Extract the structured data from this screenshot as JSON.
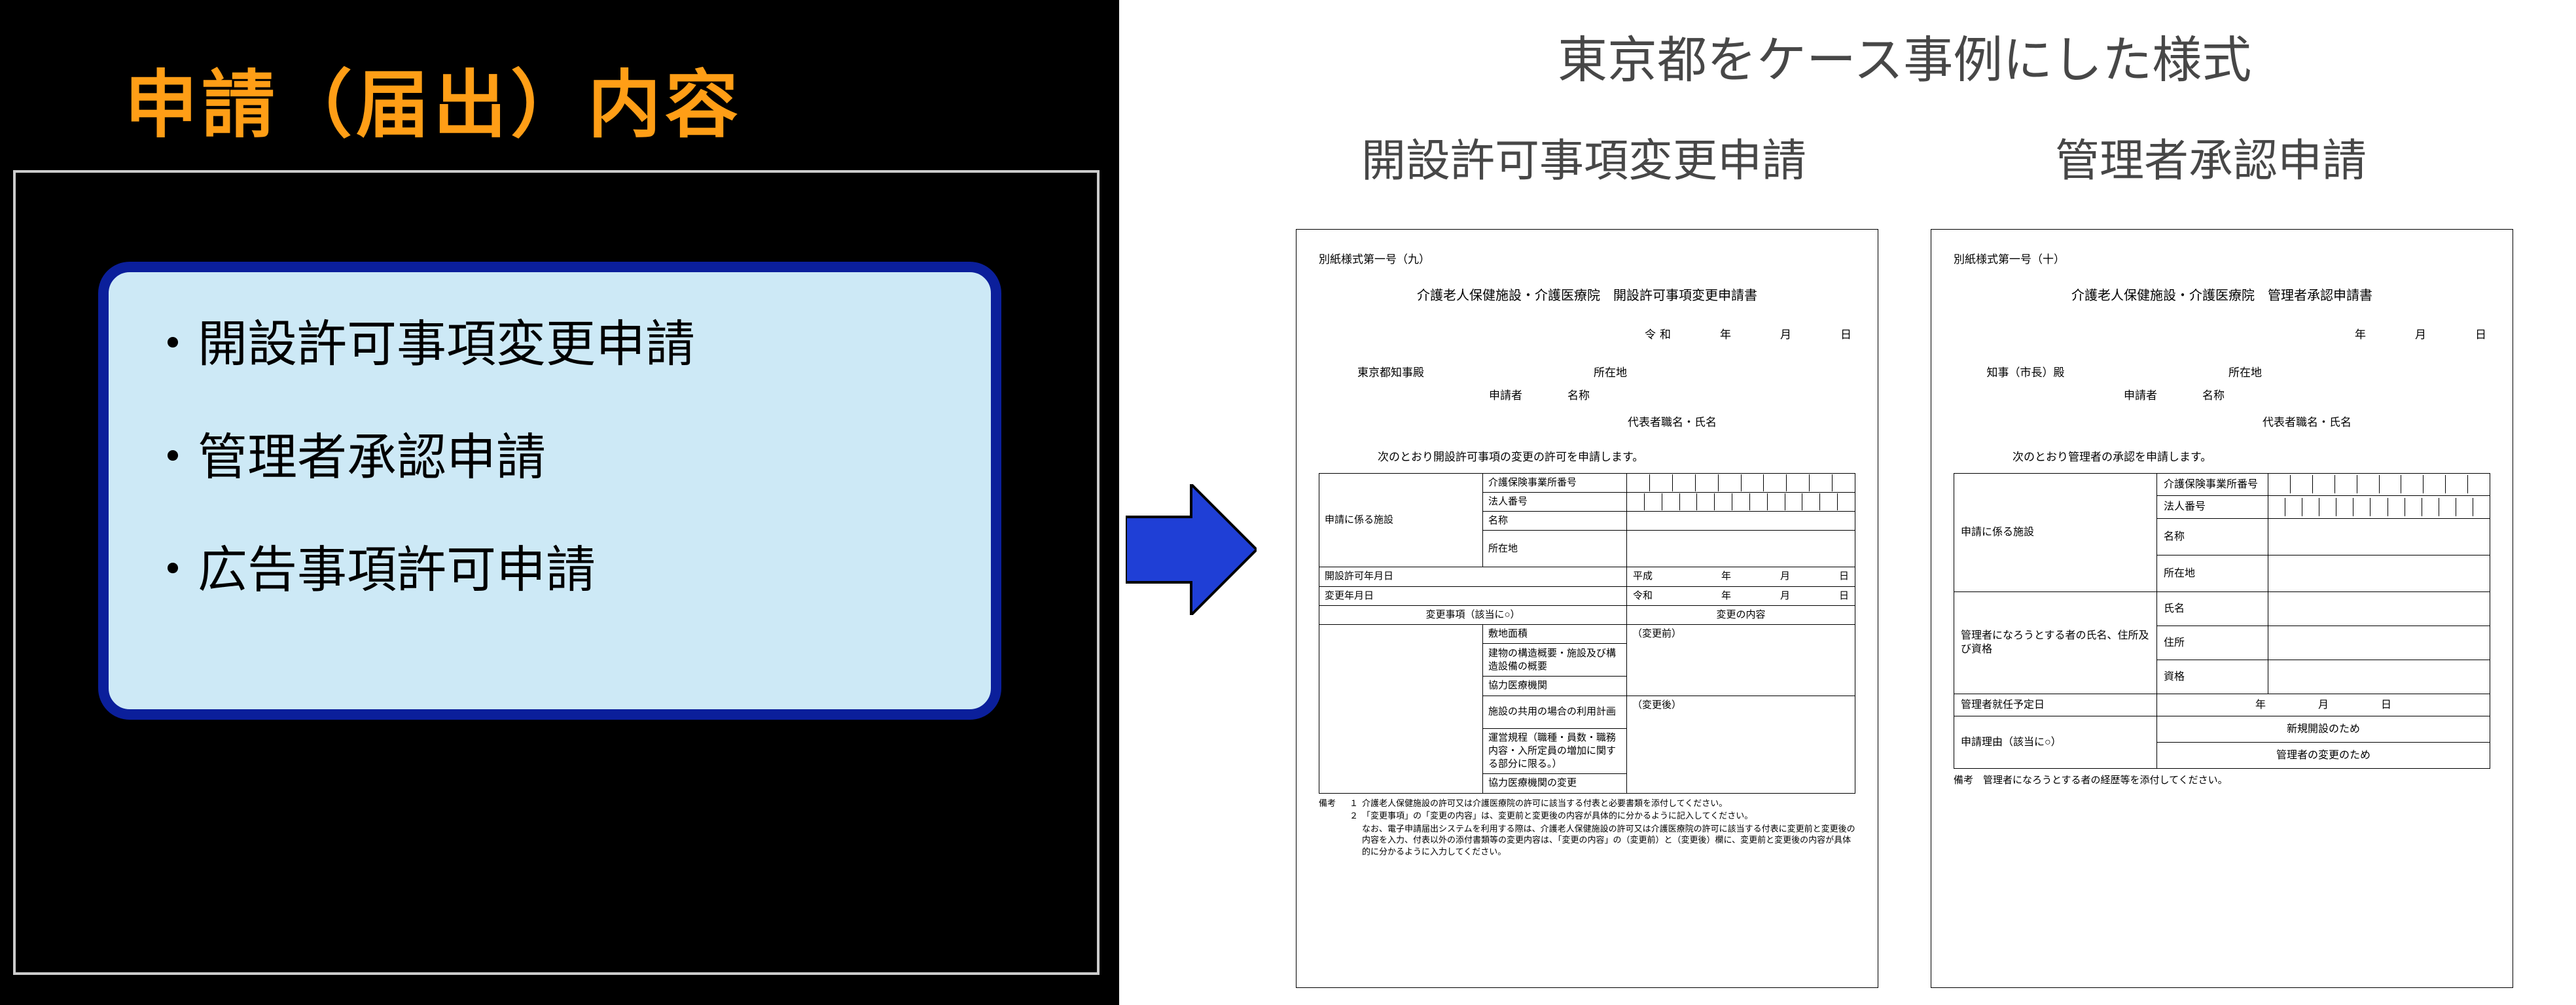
{
  "title": "申請（届出）内容",
  "bullets": [
    "・開設許可事項変更申請",
    "・管理者承認申請",
    "・広告事項許可申請"
  ],
  "topLabel": "東京都をケース事例にした様式",
  "subLabel1": "開設許可事項変更申請",
  "subLabel2": "管理者承認申請",
  "form1": {
    "code": "別紙様式第一号（九）",
    "title": "介護老人保健施設・介護医療院　開設許可事項変更申請書",
    "date": "令和　　　年　　　月　　　日",
    "recipient": "東京都知事殿",
    "addr": "所在地",
    "applicant": "申請者",
    "name": "名称",
    "rep": "代表者職名・氏名",
    "statement": "次のとおり開設許可事項の変更の許可を申請します。",
    "t": {
      "rowFac": "申請に係る施設",
      "insNo": "介護保険事業所番号",
      "corpNo": "法人番号",
      "facName": "名称",
      "facAddr": "所在地",
      "permitDate": "開設許可年月日",
      "permitVal": "平成　　　　　　　年　　　　　月　　　　　日",
      "chgDate": "変更年月日",
      "chgVal": "令和　　　　　　　年　　　　　月　　　　　日",
      "chgHdr": "変更事項（該当に○）",
      "contHdr": "変更の内容",
      "site": "敷地面積",
      "before": "（変更前）",
      "bldg": "建物の構造概要・施設及び構造設備の概要",
      "coop": "協力医療機関",
      "after": "（変更後）",
      "share": "施設の共用の場合の利用計画",
      "rules": "運営規程（職種・員数・職務内容・入所定員の増加に関する部分に限る。）",
      "medchg": "協力医療機関の変更"
    },
    "notes": {
      "label": "備考",
      "n1": "介護老人保健施設の許可又は介護医療院の許可に該当する付表と必要書類を添付してください。",
      "n2": "「変更事項」の「変更の内容」は、変更前と変更後の内容が具体的に分かるように記入してください。",
      "n2b": "なお、電子申請届出システムを利用する際は、介護老人保健施設の許可又は介護医療院の許可に該当する付表に変更前と変更後の内容を入力、付表以外の添付書類等の変更内容は、「変更の内容」の（変更前）と（変更後）欄に、変更前と変更後の内容が具体的に分かるように入力してください。"
    }
  },
  "form2": {
    "code": "別紙様式第一号（十）",
    "title": "介護老人保健施設・介護医療院　管理者承認申請書",
    "date": "年　　　月　　　日",
    "recipient": "知事（市長）殿",
    "addr": "所在地",
    "applicant": "申請者",
    "name": "名称",
    "rep": "代表者職名・氏名",
    "statement": "次のとおり管理者の承認を申請します。",
    "t": {
      "rowFac": "申請に係る施設",
      "insNo": "介護保険事業所番号",
      "corpNo": "法人番号",
      "facName": "名称",
      "facAddr": "所在地",
      "mgr": "管理者になろうとする者の氏名、住所及び資格",
      "mname": "氏名",
      "maddr": "住所",
      "mqual": "資格",
      "start": "管理者就任予定日",
      "startVal": "年　　　　　月　　　　　日",
      "reason": "申請理由（該当に○）",
      "r1": "新規開設のため",
      "r2": "管理者の変更のため"
    },
    "notes": "備考　管理者になろうとする者の経歴等を添付してください。"
  }
}
